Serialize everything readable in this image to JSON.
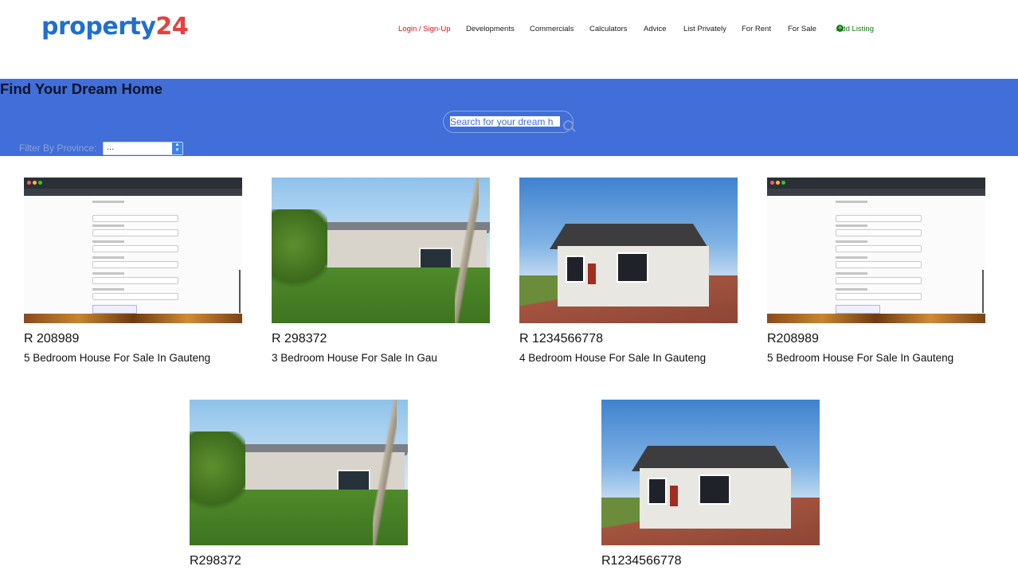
{
  "logo": {
    "part1": "property",
    "part2": "24"
  },
  "nav": {
    "login": "Login / Sign-Up",
    "developments": "Developments",
    "commercials": "Commercials",
    "calculators": "Calculators",
    "advice": "Advice",
    "list_privately": "List Privately",
    "for_rent": "For Rent",
    "for_sale": "For Sale",
    "add_listing": "Add Listing"
  },
  "hero": {
    "title": "Find Your Dream Home",
    "search_placeholder": "Search for your dream h",
    "filter_label": "Filter By Province:",
    "filter_value": "..."
  },
  "listings": [
    {
      "price": "R 208989",
      "title": "5 Bedroom House For Sale In Gauteng",
      "image": "screenshot"
    },
    {
      "price": "R 298372",
      "title": "3 Bedroom House For Sale In Gau",
      "image": "house-yard"
    },
    {
      "price": "R 1234566778",
      "title": "4 Bedroom House For Sale In Gauteng",
      "image": "house-front"
    },
    {
      "price": "R208989",
      "title": "5 Bedroom House For Sale In Gauteng",
      "image": "screenshot"
    },
    {
      "price": "R298372",
      "title": "",
      "image": "house-yard"
    },
    {
      "price": "R1234566778",
      "title": "",
      "image": "house-front"
    }
  ],
  "colors": {
    "brand_blue": "#1f6fd1",
    "brand_red": "#e8403b",
    "hero_bg": "#416ed8",
    "add_green": "#117a11"
  }
}
